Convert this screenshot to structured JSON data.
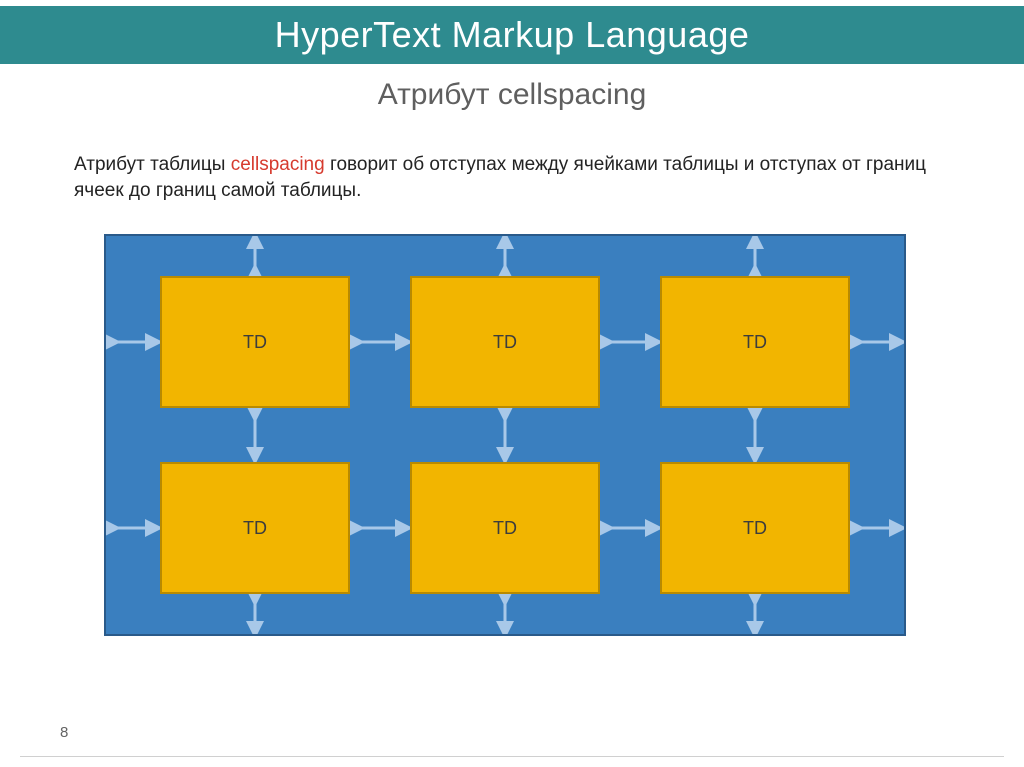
{
  "header": {
    "title": "HyperText Markup Language"
  },
  "subtitle": "Атрибут cellspacing",
  "body": {
    "prefix": "Атрибут таблицы ",
    "keyword": "cellspacing",
    "suffix": " говорит об отступах между ячейками таблицы и отступах от границ ячеек до границ самой таблицы."
  },
  "diagram": {
    "cell_label": "TD",
    "rows": 2,
    "cols": 3,
    "table_bg": "#3a7fbf",
    "cell_bg": "#f2b500",
    "arrow_color": "#a8c8e8"
  },
  "page_number": "8"
}
